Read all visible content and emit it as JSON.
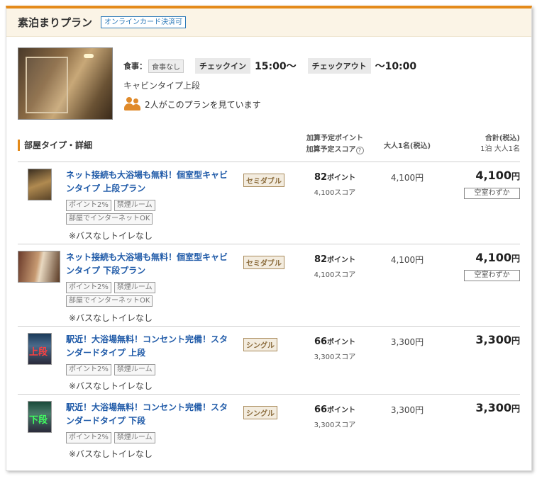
{
  "plan": {
    "title": "素泊まりプラン",
    "online_badge": "オンラインカード決済可"
  },
  "summary": {
    "meal_label": "食事：",
    "meal_value": "食事なし",
    "checkin_label": "チェックイン",
    "checkin_value": "15:00〜",
    "checkout_label": "チェックアウト",
    "checkout_value": "〜10:00",
    "room_type": "キャビンタイプ上段",
    "viewers_text": "2人がこのプランを見ています"
  },
  "table_header": {
    "title": "部屋タイプ・詳細",
    "points_line1": "加算予定ポイント",
    "points_line2": "加算予定スコア",
    "help_glyph": "?",
    "adult": "大人1名(税込)",
    "total_line1": "合計(税込)",
    "total_line2": "1泊 大人1名"
  },
  "rooms": [
    {
      "name": "ネット接続も大浴場も無料！個室型キャビンタイプ 上段プラン",
      "tags": [
        "ポイント2%",
        "禁煙ルーム",
        "部屋でインターネットOK"
      ],
      "note": "※バスなしトイレなし",
      "bed": "セミダブル",
      "points": "82",
      "points_unit": "ポイント",
      "score": "4,100スコア",
      "adult_price": "4,100円",
      "total": "4,100",
      "total_yen": "円",
      "vacancy": "空室わずか",
      "thumb_text": ""
    },
    {
      "name": "ネット接続も大浴場も無料！個室型キャビンタイプ 下段プラン",
      "tags": [
        "ポイント2%",
        "禁煙ルーム",
        "部屋でインターネットOK"
      ],
      "note": "※バスなしトイレなし",
      "bed": "セミダブル",
      "points": "82",
      "points_unit": "ポイント",
      "score": "4,100スコア",
      "adult_price": "4,100円",
      "total": "4,100",
      "total_yen": "円",
      "vacancy": "空室わずか",
      "thumb_text": ""
    },
    {
      "name": "駅近！大浴場無料！コンセント完備！スタンダードタイプ 上段",
      "tags": [
        "ポイント2%",
        "禁煙ルーム"
      ],
      "note": "※バスなしトイレなし",
      "bed": "シングル",
      "points": "66",
      "points_unit": "ポイント",
      "score": "3,300スコア",
      "adult_price": "3,300円",
      "total": "3,300",
      "total_yen": "円",
      "vacancy": "",
      "thumb_text": "上段"
    },
    {
      "name": "駅近！大浴場無料！コンセント完備！スタンダードタイプ 下段",
      "tags": [
        "ポイント2%",
        "禁煙ルーム"
      ],
      "note": "※バスなしトイレなし",
      "bed": "シングル",
      "points": "66",
      "points_unit": "ポイント",
      "score": "3,300スコア",
      "adult_price": "3,300円",
      "total": "3,300",
      "total_yen": "円",
      "vacancy": "",
      "thumb_text": "下段"
    }
  ],
  "colors": {
    "accent": "#e48a1a",
    "link": "#1f5aa8",
    "header_bg": "#fbf4e6"
  }
}
